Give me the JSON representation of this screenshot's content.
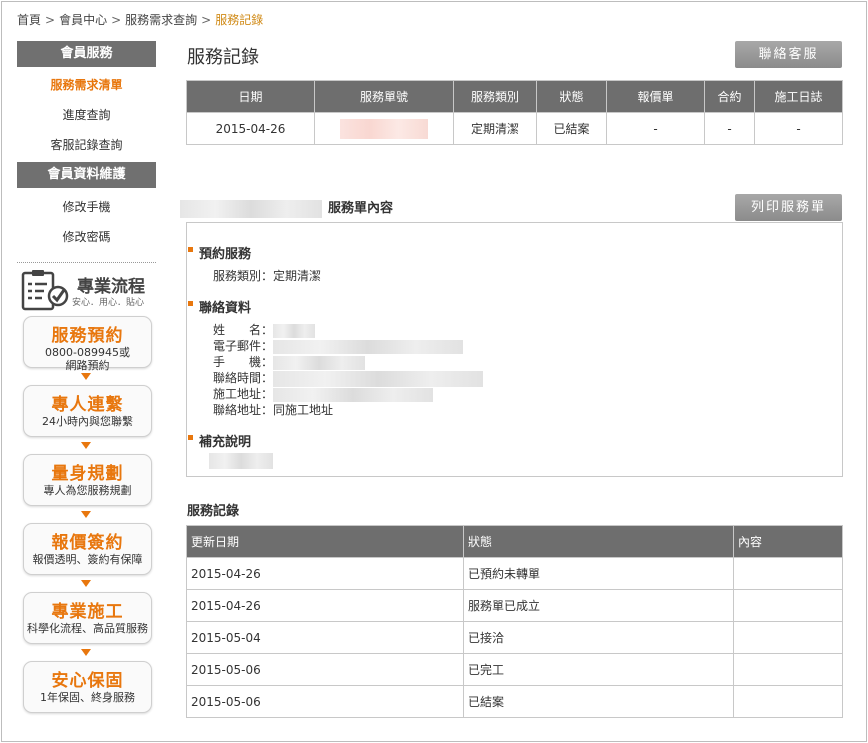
{
  "breadcrumb": [
    "首頁",
    "會員中心",
    "服務需求查詢",
    "服務記錄"
  ],
  "sidebar": {
    "member_service_title": "會員服務",
    "member_service_items": [
      "服務需求清單",
      "進度查詢",
      "客服記錄查詢"
    ],
    "member_data_title": "會員資料維護",
    "member_data_items": [
      "修改手機",
      "修改密碼"
    ]
  },
  "flow": {
    "title": "專業流程",
    "subtitle": "安心．用心．貼心",
    "steps": [
      {
        "title": "服務預約",
        "desc1": "0800-089945或",
        "desc2": "網路預約"
      },
      {
        "title": "專人連繫",
        "desc1": "24小時內與您聯繫"
      },
      {
        "title": "量身規劃",
        "desc1": "專人為您服務規劃"
      },
      {
        "title": "報價簽約",
        "desc1": "報價透明、簽約有保障"
      },
      {
        "title": "專業施工",
        "desc1": "科學化流程、高品質服務"
      },
      {
        "title": "安心保固",
        "desc1": "1年保固、終身服務"
      }
    ]
  },
  "main": {
    "title": "服務記錄",
    "contact_button": "聯絡客服",
    "print_button": "列印服務單",
    "summary_table": {
      "headers": [
        "日期",
        "服務單號",
        "服務類別",
        "狀態",
        "報價單",
        "合約",
        "施工日誌"
      ],
      "row": {
        "date": "2015-04-26",
        "category": "定期清潔",
        "status": "已結案",
        "quote": "-",
        "contract": "-",
        "log": "-"
      }
    },
    "order_content_title": "服務單內容",
    "booking": {
      "heading": "預約服務",
      "label": "服務類別：",
      "value": "定期清潔"
    },
    "contact": {
      "heading": "聯絡資料",
      "name_label": "姓　　名：",
      "email_label": "電子郵件：",
      "phone_label": "手　　機：",
      "time_label": "聯絡時間：",
      "site_label": "施工地址：",
      "addr_label": "聯絡地址：",
      "addr_value": "同施工地址"
    },
    "note_heading": "補充說明",
    "records_title": "服務記錄",
    "records": {
      "headers": [
        "更新日期",
        "狀態",
        "內容"
      ],
      "rows": [
        {
          "date": "2015-04-26",
          "status": "已預約未轉單",
          "content": ""
        },
        {
          "date": "2015-04-26",
          "status": "服務單已成立",
          "content": ""
        },
        {
          "date": "2015-05-04",
          "status": "已接洽",
          "content": ""
        },
        {
          "date": "2015-05-06",
          "status": "已完工",
          "content": ""
        },
        {
          "date": "2015-05-06",
          "status": "已結案",
          "content": ""
        }
      ]
    }
  },
  "colors": {
    "accent": "#e8770e",
    "header_gray": "#6e6e6e",
    "breadcrumb_current": "#d08a16"
  }
}
